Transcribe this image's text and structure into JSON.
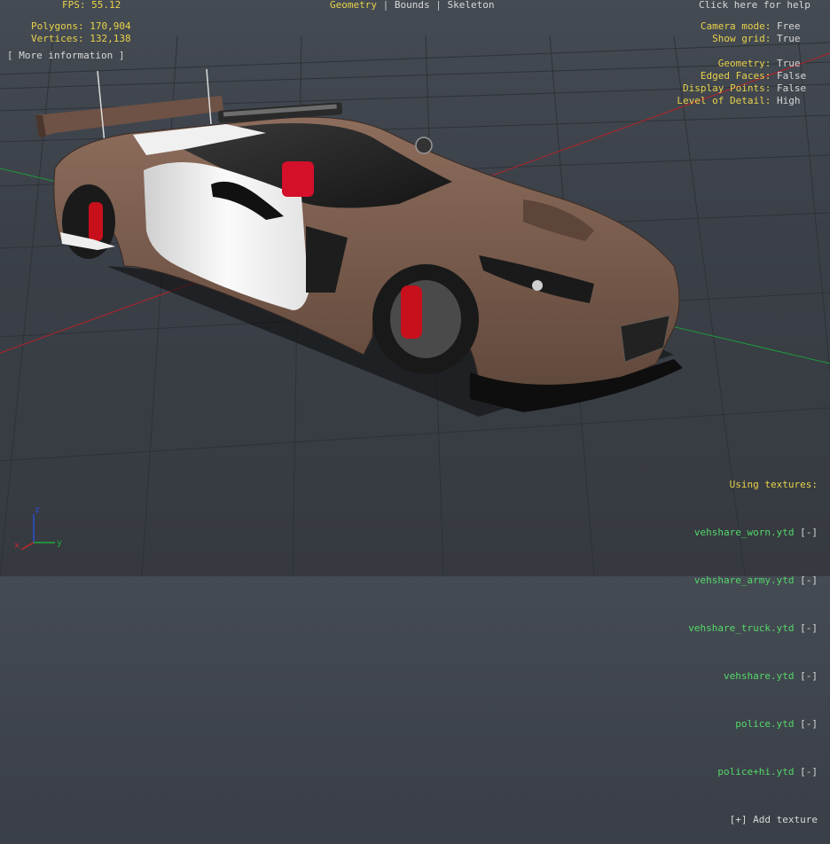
{
  "fps": {
    "label": "FPS:",
    "value": "55.12"
  },
  "tabs": [
    {
      "label": "Geometry",
      "active": true
    },
    {
      "label": "Bounds",
      "active": false
    },
    {
      "label": "Skeleton",
      "active": false
    }
  ],
  "help_link": "Click here for help",
  "stats": {
    "polygons": {
      "label": "Polygons:",
      "value": "170,904"
    },
    "vertices": {
      "label": "Vertices:",
      "value": "132,138"
    }
  },
  "more_info": "[ More information ]",
  "camera": {
    "mode": {
      "label": "Camera mode:",
      "value": "Free"
    },
    "grid": {
      "label": "Show grid:",
      "value": "True"
    }
  },
  "display": {
    "geometry": {
      "label": "Geometry:",
      "value": "True"
    },
    "edged_faces": {
      "label": "Edged Faces:",
      "value": "False"
    },
    "display_points": {
      "label": "Display Points:",
      "value": "False"
    },
    "lod": {
      "label": "Level of Detail:",
      "value": "High"
    }
  },
  "textures": {
    "heading": "Using textures:",
    "items": [
      {
        "name": "vehshare_worn.ytd",
        "remove": "[-]"
      },
      {
        "name": "vehshare_army.ytd",
        "remove": "[-]"
      },
      {
        "name": "vehshare_truck.ytd",
        "remove": "[-]"
      },
      {
        "name": "vehshare.ytd",
        "remove": "[-]"
      },
      {
        "name": "police.ytd",
        "remove": "[-]"
      },
      {
        "name": "police+hi.ytd",
        "remove": "[-]"
      }
    ],
    "add": "[+] Add texture"
  },
  "axis": {
    "x": "x",
    "y": "y",
    "z": "z"
  },
  "colors": {
    "hud_yellow": "#e8d24a",
    "hud_white": "#d8d8d8",
    "texture_green": "#53d86a",
    "car_body": "#7c5f50",
    "car_white": "#f2f2f2",
    "brake_red": "#c8101c"
  }
}
